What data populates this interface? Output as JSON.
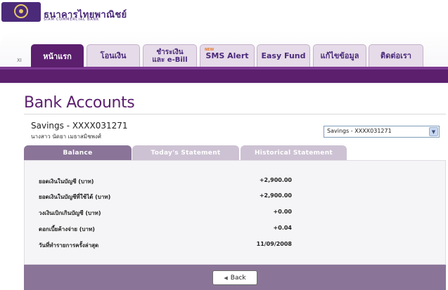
{
  "header": {
    "bank_name_th": "ธนาคารไทยพาณิชย์",
    "bank_name_en": "SIAM COMMERCIAL BANK",
    "logo_icon": "scb-emblem-icon"
  },
  "nav": {
    "close_label": "XI",
    "tabs": [
      {
        "label": "หน้าแรก",
        "active": true
      },
      {
        "label": "โอนเงิน",
        "active": false
      },
      {
        "label_line1": "ชำระเงิน",
        "label_line2": "และ e-Bill",
        "active": false
      },
      {
        "label": "SMS Alert",
        "badge": "NEW",
        "active": false
      },
      {
        "label": "Easy Fund",
        "active": false
      },
      {
        "label": "แก้ไขข้อมูล",
        "active": false
      },
      {
        "label": "ติดต่อเรา",
        "active": false
      }
    ]
  },
  "page": {
    "title": "Bank Accounts"
  },
  "account": {
    "name": "Savings - XXXX031271",
    "holder": "นางสาว นัดยา เมธาสมิชพงศ์",
    "selector_value": "Savings - XXXX031271"
  },
  "subtabs": [
    {
      "label": "Balance",
      "active": true
    },
    {
      "label": "Today's Statement",
      "active": false
    },
    {
      "label": "Historical Statement",
      "active": false
    }
  ],
  "balance": {
    "rows": [
      {
        "label": "ยอดเงินในบัญชี (บาท)",
        "value": "+2,900.00"
      },
      {
        "label": "ยอดเงินในบัญชีที่ใช้ได้ (บาท)",
        "value": "+2,900.00"
      },
      {
        "label": "วงเงินเบิกเกินบัญชี (บาท)",
        "value": "+0.00"
      },
      {
        "label": "ดอกเบี้ยค้างจ่าย (บาท)",
        "value": "+0.04"
      },
      {
        "label": "วันที่ทำรายการครั้งล่าสุด",
        "value": "11/09/2008"
      }
    ]
  },
  "footer": {
    "back_label": "Back"
  },
  "colors": {
    "brand_purple": "#5b1f6e",
    "subtab_active": "#8a7598",
    "subtab_inactive": "#cdc2d3"
  }
}
